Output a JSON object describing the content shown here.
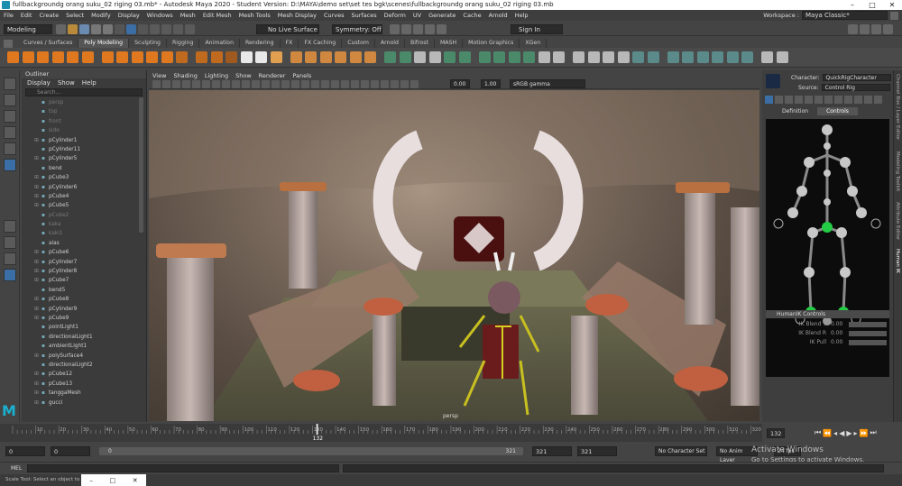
{
  "window": {
    "title": "fullbackgroundg orang suku_02 riging 03.mb* - Autodesk Maya 2020 - Student Version: D:\\MAYA\\demo set\\set tes bgk\\scenes\\fullbackgroundg orang suku_02 riging 03.mb",
    "minimize": "–",
    "maximize": "□",
    "close": "✕"
  },
  "menubar": [
    "File",
    "Edit",
    "Create",
    "Select",
    "Modify",
    "Display",
    "Windows",
    "Mesh",
    "Edit Mesh",
    "Mesh Tools",
    "Mesh Display",
    "Curves",
    "Surfaces",
    "Deform",
    "UV",
    "Generate",
    "Cache",
    "Arnold",
    "Help"
  ],
  "workspace": {
    "label": "Workspace :",
    "value": "Maya Classic*"
  },
  "statusline": {
    "mode": "Modeling",
    "live_surface": "No Live Surface",
    "symmetry": "Symmetry: Off",
    "sign_in": "Sign In"
  },
  "shelf_tabs": [
    "Curves / Surfaces",
    "Poly Modeling",
    "Sculpting",
    "Rigging",
    "Animation",
    "Rendering",
    "FX",
    "FX Caching",
    "Custom",
    "Arnold",
    "Bifrost",
    "MASH",
    "Motion Graphics",
    "XGen"
  ],
  "shelf_active": "Poly Modeling",
  "outliner": {
    "title": "Outliner",
    "menu": [
      "Display",
      "Show",
      "Help"
    ],
    "search_placeholder": "Search...",
    "items": [
      {
        "label": "persp",
        "dim": true,
        "plus": false
      },
      {
        "label": "top",
        "dim": true,
        "plus": false
      },
      {
        "label": "front",
        "dim": true,
        "plus": false
      },
      {
        "label": "side",
        "dim": true,
        "plus": false
      },
      {
        "label": "pCylinder1",
        "dim": false,
        "plus": true
      },
      {
        "label": "pCylinder11",
        "dim": false,
        "plus": false
      },
      {
        "label": "pCylinder5",
        "dim": false,
        "plus": true
      },
      {
        "label": "bend",
        "dim": false,
        "plus": false
      },
      {
        "label": "pCube3",
        "dim": false,
        "plus": true
      },
      {
        "label": "pCylinder6",
        "dim": false,
        "plus": true
      },
      {
        "label": "pCube4",
        "dim": false,
        "plus": true
      },
      {
        "label": "pCube5",
        "dim": false,
        "plus": true
      },
      {
        "label": "pCube2",
        "dim": true,
        "plus": false
      },
      {
        "label": "kaka",
        "dim": true,
        "plus": false
      },
      {
        "label": "kaki1",
        "dim": true,
        "plus": false
      },
      {
        "label": "alas",
        "dim": false,
        "plus": false
      },
      {
        "label": "pCube6",
        "dim": false,
        "plus": true
      },
      {
        "label": "pCylinder7",
        "dim": false,
        "plus": true
      },
      {
        "label": "pCylinder8",
        "dim": false,
        "plus": true
      },
      {
        "label": "pCube7",
        "dim": false,
        "plus": true
      },
      {
        "label": "bend5",
        "dim": false,
        "plus": false
      },
      {
        "label": "pCube8",
        "dim": false,
        "plus": true
      },
      {
        "label": "pCylinder9",
        "dim": false,
        "plus": true
      },
      {
        "label": "pCube9",
        "dim": false,
        "plus": true
      },
      {
        "label": "pointLight1",
        "dim": false,
        "plus": false
      },
      {
        "label": "directionalLight1",
        "dim": false,
        "plus": false
      },
      {
        "label": "ambientLight1",
        "dim": false,
        "plus": false
      },
      {
        "label": "polySurface4",
        "dim": false,
        "plus": true
      },
      {
        "label": "directionalLight2",
        "dim": false,
        "plus": false
      },
      {
        "label": "pCube12",
        "dim": false,
        "plus": true
      },
      {
        "label": "pCube13",
        "dim": false,
        "plus": true
      },
      {
        "label": "tanggaMesh",
        "dim": false,
        "plus": true
      },
      {
        "label": "gucci",
        "dim": false,
        "plus": true
      }
    ]
  },
  "viewport": {
    "menu": [
      "View",
      "Shading",
      "Lighting",
      "Show",
      "Renderer",
      "Panels"
    ],
    "exposure": "0.00",
    "gamma": "1.00",
    "color_space": "sRGB gamma",
    "camera_label": "persp"
  },
  "humanik": {
    "character_label": "Character:",
    "character_value": "QuickRigCharacter",
    "source_label": "Source:",
    "source_value": "Control Rig",
    "tabs": [
      "Definition",
      "Controls"
    ],
    "active_tab": "Controls",
    "controls_header": "HumanIK Controls",
    "params": [
      {
        "label": "IK Blend T",
        "value": "0.00"
      },
      {
        "label": "IK Blend R",
        "value": "0.00"
      },
      {
        "label": "IK Pull",
        "value": "0.00"
      }
    ]
  },
  "side_tabs": [
    "Channel Box / Layer Editor",
    "Modeling Toolkit",
    "Attribute Editor",
    "Human IK"
  ],
  "timeslider": {
    "ticks": [
      "10",
      "20",
      "30",
      "40",
      "50",
      "60",
      "70",
      "80",
      "90",
      "100",
      "110",
      "120",
      "130",
      "140",
      "150",
      "160",
      "170",
      "180",
      "190",
      "200",
      "210",
      "220",
      "230",
      "240",
      "250",
      "260",
      "270",
      "280",
      "290",
      "300",
      "310",
      "320"
    ],
    "current_frame_label": "132",
    "current_frame_field": "132"
  },
  "range": {
    "start": "0",
    "anim_start": "0",
    "range_start": "0",
    "range_end": "321",
    "anim_end": "321",
    "end": "321",
    "character_set": "No Character Set",
    "anim_layer": "No Anim Layer",
    "fps": "24 fps"
  },
  "cmdline": {
    "label": "MEL"
  },
  "helpline": {
    "text": "Scale Tool: Select an object to sc"
  },
  "watermark": {
    "title": "Activate Windows",
    "subtitle": "Go to Settings to activate Windows."
  },
  "colors": {
    "accent": "#5a8fc9",
    "skeleton_green": "#22cc44",
    "timeslider_marker": "#e0e0e0"
  }
}
